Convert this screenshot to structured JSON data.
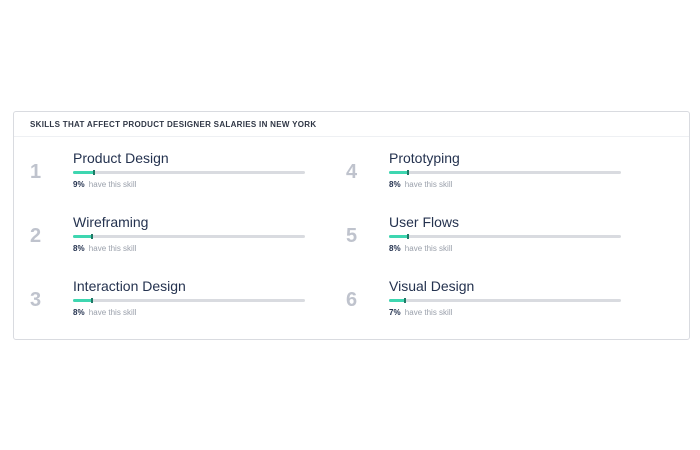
{
  "panel": {
    "title": "SKILLS THAT AFFECT PRODUCT DESIGNER SALARIES IN NEW YORK"
  },
  "colors": {
    "accent": "#3ed6b0",
    "track": "#d9dbe0",
    "rank": "#bfc3cd",
    "name": "#24324f"
  },
  "skills": [
    {
      "rank": "1",
      "name": "Product Design",
      "percent": "9%",
      "fraction": 0.09,
      "suffix": "have this skill"
    },
    {
      "rank": "2",
      "name": "Wireframing",
      "percent": "8%",
      "fraction": 0.08,
      "suffix": "have this skill"
    },
    {
      "rank": "3",
      "name": "Interaction Design",
      "percent": "8%",
      "fraction": 0.08,
      "suffix": "have this skill"
    },
    {
      "rank": "4",
      "name": "Prototyping",
      "percent": "8%",
      "fraction": 0.08,
      "suffix": "have this skill"
    },
    {
      "rank": "5",
      "name": "User Flows",
      "percent": "8%",
      "fraction": 0.08,
      "suffix": "have this skill"
    },
    {
      "rank": "6",
      "name": "Visual Design",
      "percent": "7%",
      "fraction": 0.07,
      "suffix": "have this skill"
    }
  ]
}
